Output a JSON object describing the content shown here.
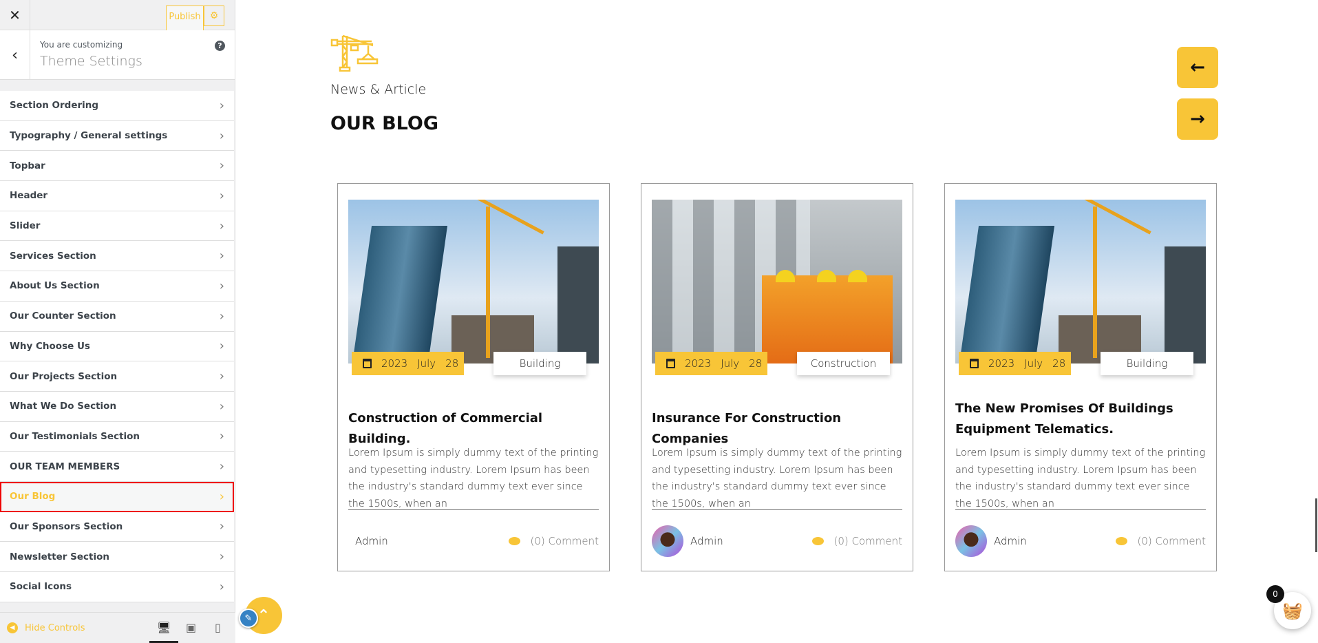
{
  "sidebar": {
    "close_icon": "close-icon",
    "publish_label": "Publish",
    "settings_icon": "gear-icon",
    "customizing_label": "You are customizing",
    "customizing_title": "Theme Settings",
    "items": [
      {
        "label": "Section Ordering"
      },
      {
        "label": "Typography / General settings"
      },
      {
        "label": "Topbar"
      },
      {
        "label": "Header"
      },
      {
        "label": "Slider"
      },
      {
        "label": "Services Section"
      },
      {
        "label": "About Us Section"
      },
      {
        "label": "Our Counter Section"
      },
      {
        "label": "Why Choose Us"
      },
      {
        "label": "Our Projects Section"
      },
      {
        "label": "What We Do Section"
      },
      {
        "label": "Our Testimonials Section"
      },
      {
        "label": "OUR TEAM MEMBERS"
      },
      {
        "label": "Our Blog",
        "active": true
      },
      {
        "label": "Our Sponsors Section"
      },
      {
        "label": "Newsletter Section"
      },
      {
        "label": "Social Icons"
      }
    ],
    "hide_controls": "Hide Controls",
    "devices": [
      "desktop",
      "tablet",
      "mobile"
    ],
    "active_device": "desktop"
  },
  "main": {
    "kicker": "News & Article",
    "heading": "OUR BLOG",
    "posts": [
      {
        "year": "2023",
        "month": "July",
        "day": "28",
        "category": "Building",
        "title": "Construction of Commercial Building.",
        "excerpt": "Lorem Ipsum is simply dummy text of the printing and typesetting industry. Lorem Ipsum has been the industry's standard dummy text ever since the 1500s, when an",
        "author": "Admin",
        "comments": "(0) Comment",
        "avatar": false
      },
      {
        "year": "2023",
        "month": "July",
        "day": "28",
        "category": "Construction",
        "title": "Insurance For Construction Companies",
        "excerpt": "Lorem Ipsum is simply dummy text of the printing and typesetting industry. Lorem Ipsum has been the industry's standard dummy text ever since the 1500s, when an",
        "author": "Admin",
        "comments": "(0) Comment",
        "avatar": true
      },
      {
        "year": "2023",
        "month": "July",
        "day": "28",
        "category": "Building",
        "title": "The New Promises Of Buildings Equipment Telematics.",
        "excerpt": "Lorem Ipsum is simply dummy text of the printing and typesetting industry. Lorem Ipsum has been the industry's standard dummy text ever since the 1500s, when an",
        "author": "Admin",
        "comments": "(0) Comment",
        "avatar": true
      }
    ],
    "cart_count": "0"
  },
  "colors": {
    "accent": "#f8c537",
    "highlight": "#e00000",
    "edit": "#3582c4"
  }
}
